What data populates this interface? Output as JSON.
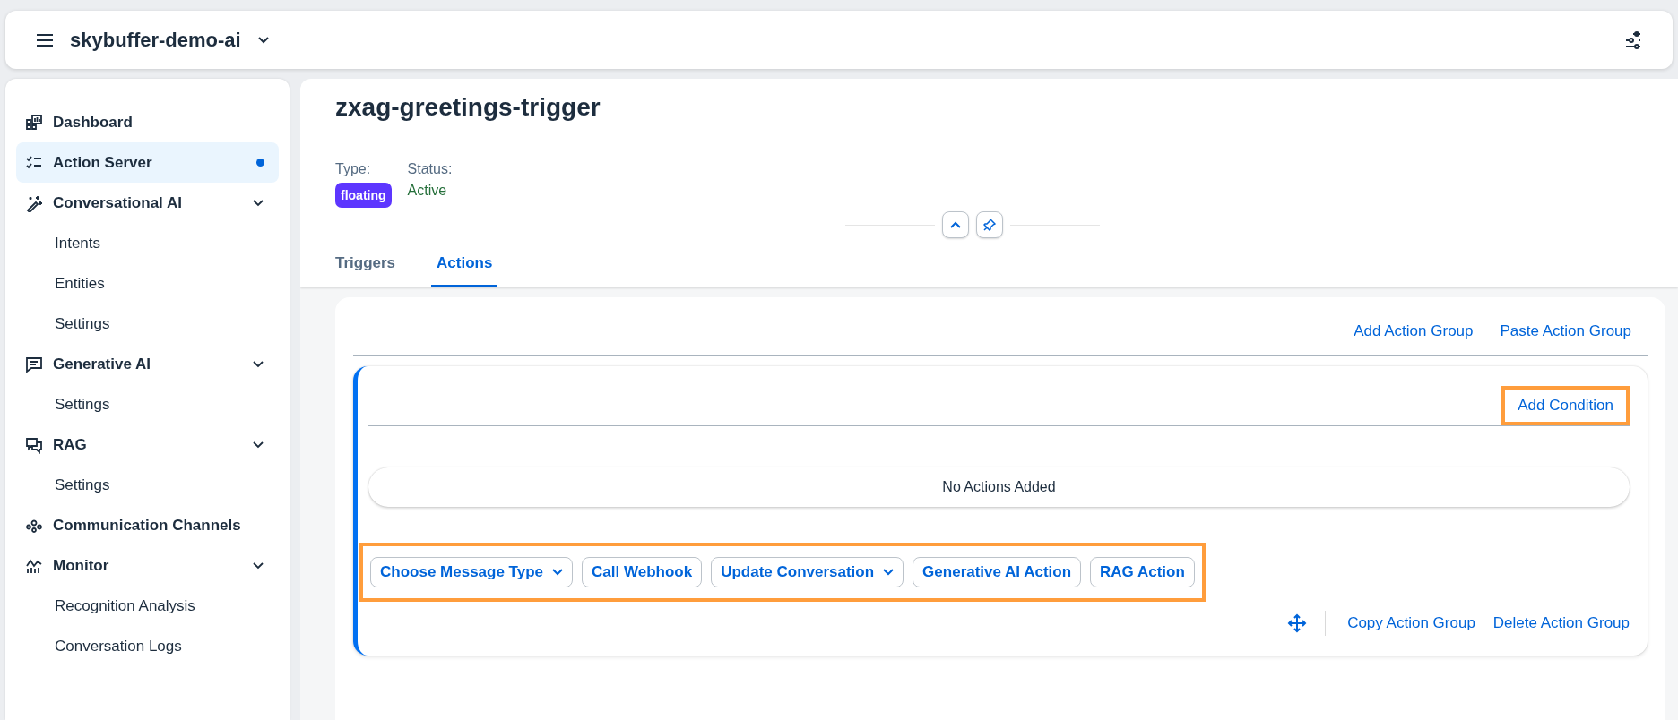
{
  "header": {
    "title": "skybuffer-demo-ai"
  },
  "sidebar": {
    "items": [
      {
        "label": "Dashboard",
        "selected": false
      },
      {
        "label": "Action Server",
        "selected": true
      },
      {
        "label": "Conversational AI",
        "selected": false,
        "expanded": true,
        "children": [
          {
            "label": "Intents",
            "selected": false
          },
          {
            "label": "Entities",
            "selected": false
          },
          {
            "label": "Settings",
            "selected": false
          }
        ]
      },
      {
        "label": "Generative AI",
        "selected": false,
        "expanded": true,
        "children": [
          {
            "label": "Settings",
            "selected": false
          }
        ]
      },
      {
        "label": "RAG",
        "selected": false,
        "expanded": true,
        "children": [
          {
            "label": "Settings",
            "selected": false
          }
        ]
      },
      {
        "label": "Communication Channels",
        "selected": false
      },
      {
        "label": "Monitor",
        "selected": false,
        "expanded": true,
        "children": [
          {
            "label": "Recognition Analysis",
            "selected": false
          },
          {
            "label": "Conversation Logs",
            "selected": false
          }
        ]
      }
    ]
  },
  "object": {
    "title": "zxag-greetings-trigger",
    "type_label": "Type:",
    "type_value": "floating",
    "status_label": "Status:",
    "status_value": "Active"
  },
  "tabs": [
    {
      "label": "Triggers",
      "selected": false
    },
    {
      "label": "Actions",
      "selected": true
    }
  ],
  "toolbar": [
    "Add Action Group",
    "Paste Action Group"
  ],
  "action_group": {
    "add_condition": {
      "label": "Add Condition",
      "highlighted": true
    },
    "empty_text": "No Actions Added",
    "actions_highlighted": true,
    "actions": [
      {
        "label": "Choose Message Type",
        "dropdown": true
      },
      {
        "label": "Call Webhook",
        "dropdown": false
      },
      {
        "label": "Update Conversation",
        "dropdown": true
      },
      {
        "label": "Generative AI Action",
        "dropdown": false
      },
      {
        "label": "RAG Action",
        "dropdown": false
      }
    ],
    "footer": [
      "Copy Action Group",
      "Delete Action Group"
    ]
  }
}
